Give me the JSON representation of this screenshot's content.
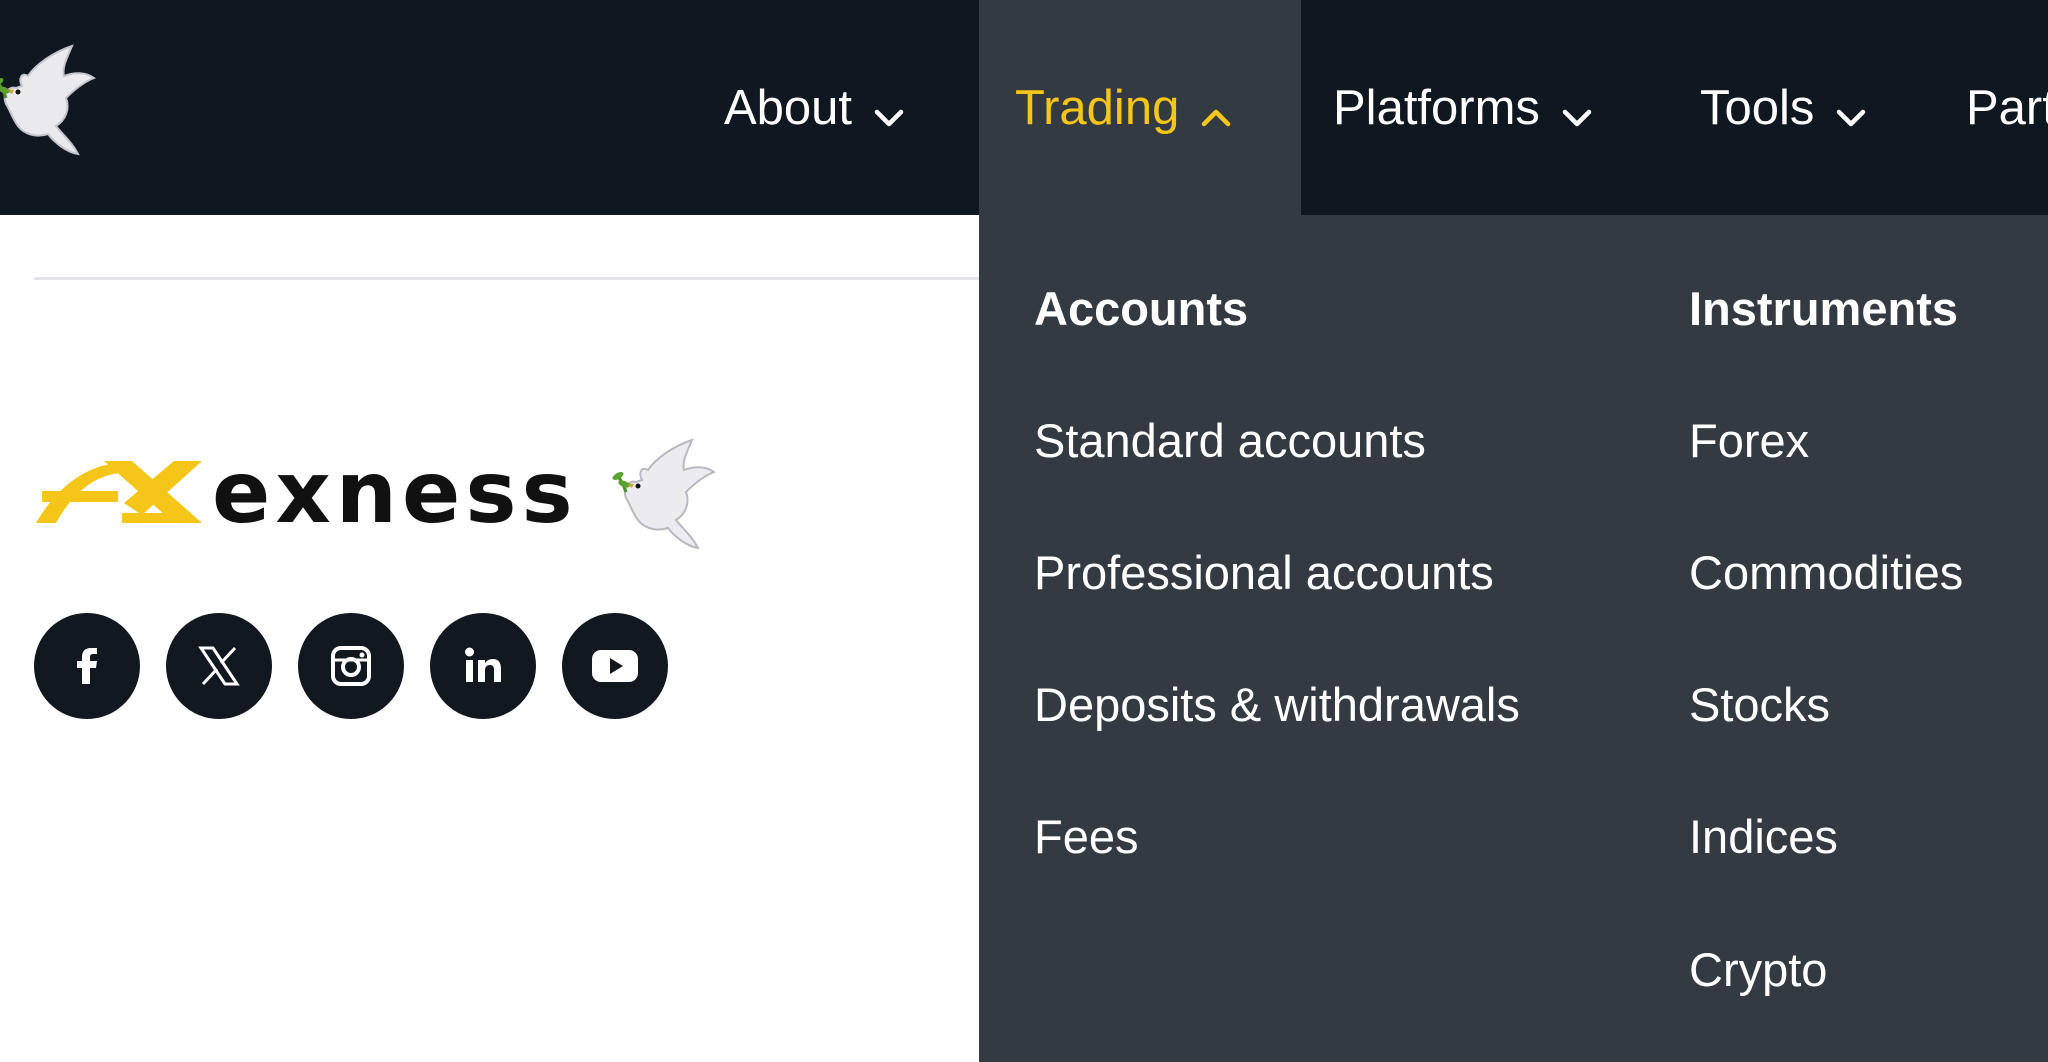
{
  "nav": {
    "items": [
      {
        "label": "About",
        "icon": "chevron-down-icon"
      },
      {
        "label": "Trading",
        "icon": "chevron-up-icon",
        "active": true
      },
      {
        "label": "Platforms",
        "icon": "chevron-down-icon"
      },
      {
        "label": "Tools",
        "icon": "chevron-down-icon"
      },
      {
        "label": "Part"
      }
    ]
  },
  "brand": {
    "name": "exness",
    "logo_icon": "exness-logo-mark",
    "mascot_icon": "dove-icon"
  },
  "socials": [
    {
      "network": "Facebook",
      "icon": "facebook-icon"
    },
    {
      "network": "X",
      "icon": "x-icon"
    },
    {
      "network": "Instagram",
      "icon": "instagram-icon"
    },
    {
      "network": "LinkedIn",
      "icon": "linkedin-icon"
    },
    {
      "network": "YouTube",
      "icon": "youtube-icon"
    }
  ],
  "dropdown": {
    "accounts": {
      "heading": "Accounts",
      "links": [
        "Standard accounts",
        "Professional accounts",
        "Deposits & withdrawals",
        "Fees"
      ]
    },
    "instruments": {
      "heading": "Instruments",
      "links": [
        "Forex",
        "Commodities",
        "Stocks",
        "Indices",
        "Crypto"
      ]
    }
  },
  "colors": {
    "topbar": "#0f1720",
    "dropdown": "#343a42",
    "accent": "#f5c518"
  }
}
